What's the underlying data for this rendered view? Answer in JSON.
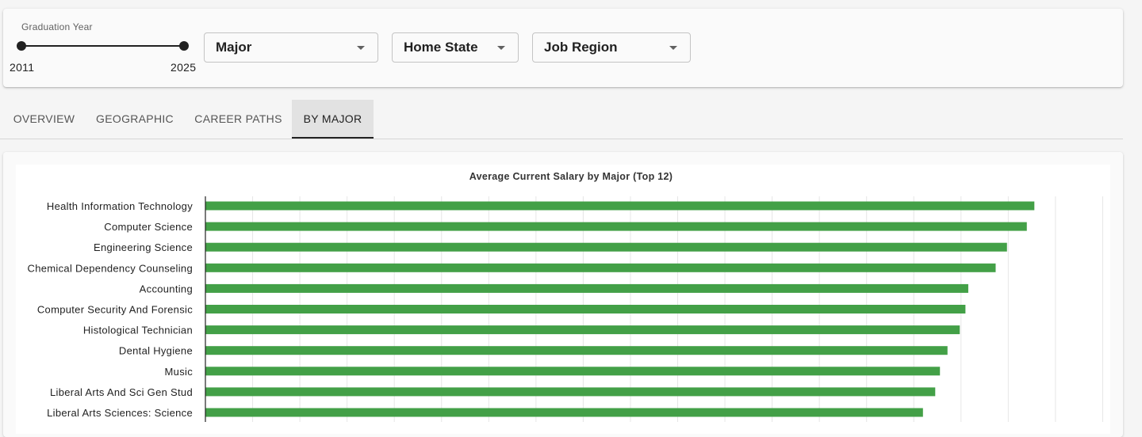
{
  "filters": {
    "graduation_year": {
      "label": "Graduation Year",
      "min_label": "2011",
      "max_label": "2025",
      "range": [
        2011,
        2025
      ],
      "selected": [
        2011,
        2025
      ]
    },
    "major_select": {
      "label": "Major"
    },
    "home_state_select": {
      "label": "Home State"
    },
    "job_region_select": {
      "label": "Job Region"
    }
  },
  "tabs": [
    {
      "label": "OVERVIEW",
      "active": false
    },
    {
      "label": "GEOGRAPHIC",
      "active": false
    },
    {
      "label": "CAREER PATHS",
      "active": false
    },
    {
      "label": "BY MAJOR",
      "active": true
    }
  ],
  "colors": {
    "bar": "#43a047",
    "axis": "#222222",
    "grid": "#e6e6e6"
  },
  "chart_data": {
    "type": "bar",
    "orientation": "horizontal",
    "title": "Average Current Salary by Major (Top 12)",
    "categories": [
      "Health Information Technology",
      "Computer Science",
      "Engineering Science",
      "Chemical Dependency Counseling",
      "Accounting",
      "Computer Security And Forensic",
      "Histological Technician",
      "Dental Hygiene",
      "Music",
      "Liberal Arts And Sci Gen Stud",
      "Liberal Arts Sciences: Science"
    ],
    "values": [
      87.8,
      87.0,
      84.9,
      83.7,
      80.8,
      80.5,
      79.9,
      78.6,
      77.8,
      77.3,
      76.0
    ],
    "xlim": [
      0,
      95
    ],
    "grid": true,
    "legend": "none"
  }
}
